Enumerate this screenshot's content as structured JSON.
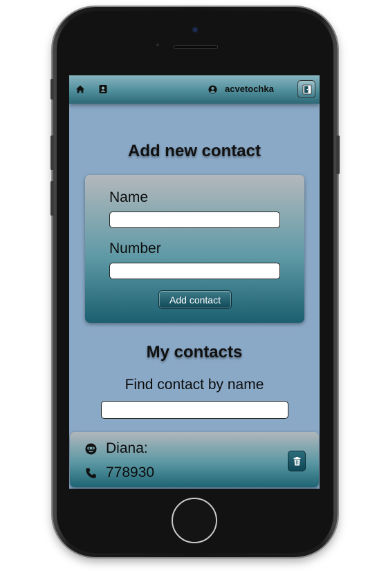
{
  "header": {
    "username": "acvetochka",
    "icons": [
      "home-icon",
      "contacts-book-icon",
      "user-circle-icon",
      "logout-door-icon"
    ]
  },
  "add_form": {
    "title": "Add new contact",
    "name_label": "Name",
    "name_value": "",
    "number_label": "Number",
    "number_value": "",
    "submit_label": "Add contact"
  },
  "contacts": {
    "title": "My contacts",
    "filter_label": "Find contact by name",
    "filter_value": "",
    "items": [
      {
        "name": "Diana:",
        "number": "778930",
        "icons": [
          "face-icon",
          "phone-icon",
          "trash-icon"
        ]
      }
    ]
  },
  "colors": {
    "screen_bg": "#8aa9c7",
    "accent_teal": "#2d6876",
    "button_dark": "#0f4756"
  }
}
